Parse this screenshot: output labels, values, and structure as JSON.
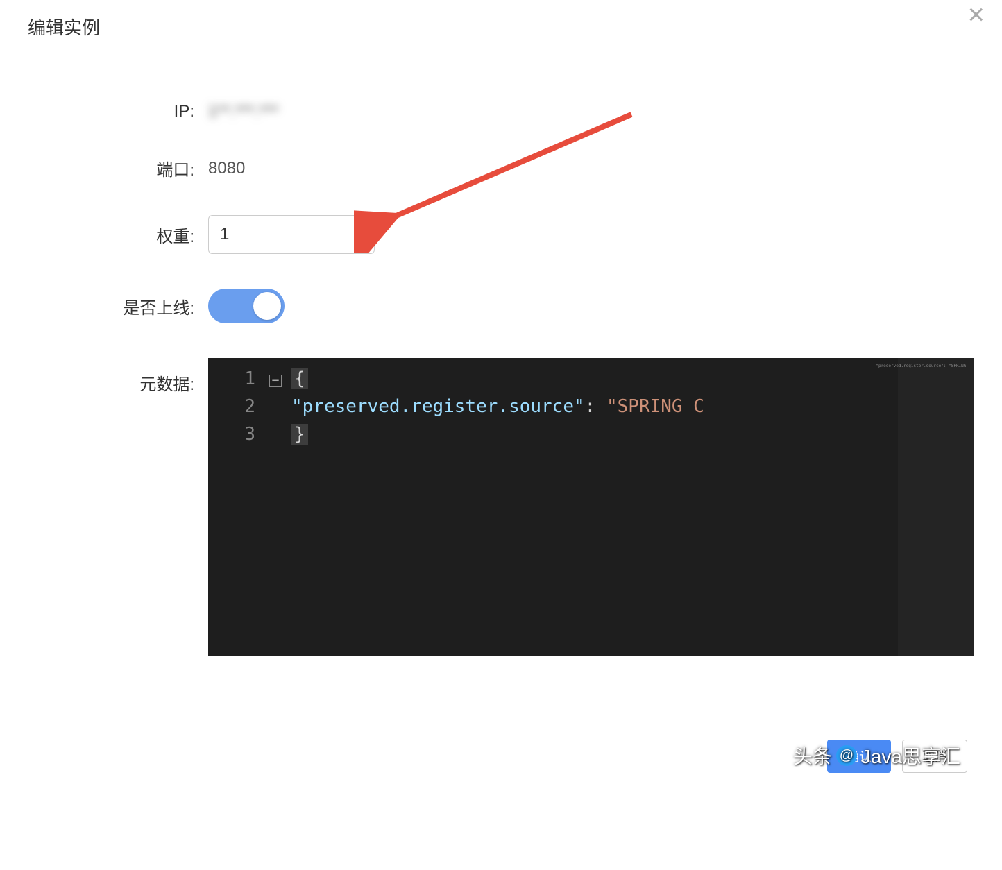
{
  "dialog": {
    "title": "编辑实例"
  },
  "form": {
    "ip_label": "IP:",
    "ip_value": "1**.***.***",
    "port_label": "端口:",
    "port_value": "8080",
    "weight_label": "权重:",
    "weight_value": "1",
    "online_label": "是否上线:",
    "online_value": true,
    "metadata_label": "元数据:"
  },
  "editor": {
    "lines": [
      "1",
      "2",
      "3"
    ],
    "content": {
      "line1_open": "{",
      "line2_indent": "    ",
      "line2_key": "\"preserved.register.source\"",
      "line2_colon": ": ",
      "line2_val": "\"SPRING_C",
      "line3_close": "}"
    },
    "minimap_hint": "\"preserved.register.source\": \"SPRING_"
  },
  "footer": {
    "confirm": "确认",
    "cancel": "取消"
  },
  "watermark": {
    "prefix": "头条",
    "at": "@",
    "name": "Java思享汇"
  }
}
